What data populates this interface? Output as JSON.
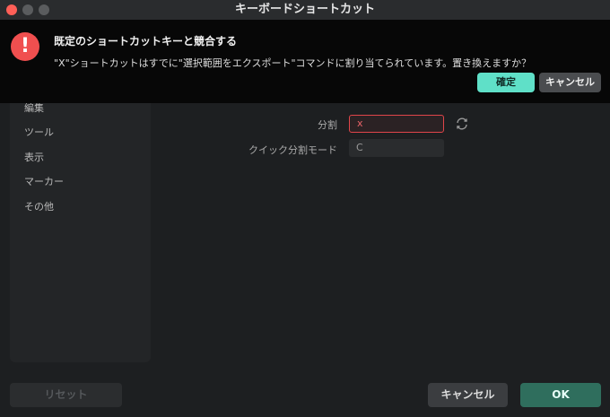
{
  "window": {
    "title": "キーボードショートカット"
  },
  "sidebar": {
    "items": [
      {
        "label": "編集"
      },
      {
        "label": "ツール"
      },
      {
        "label": "表示"
      },
      {
        "label": "マーカー"
      },
      {
        "label": "その他"
      }
    ]
  },
  "fields": {
    "split": {
      "label": "分割",
      "value": "x"
    },
    "quick_split": {
      "label": "クイック分割モード",
      "value": "C"
    }
  },
  "footer": {
    "reset_label": "リセット",
    "cancel_label": "キャンセル",
    "ok_label": "OK"
  },
  "alert": {
    "icon_glyph": "!",
    "title": "既定のショートカットキーと競合する",
    "message": "\"X\"ショートカットはすでに\"選択範囲をエクスポート\"コマンドに割り当てられています。置き換えますか？",
    "confirm_label": "確定",
    "cancel_label": "キャンセル"
  },
  "colors": {
    "accent": "#5fe0c8",
    "error": "#e0454a",
    "ok_button": "#2f6e5d"
  }
}
